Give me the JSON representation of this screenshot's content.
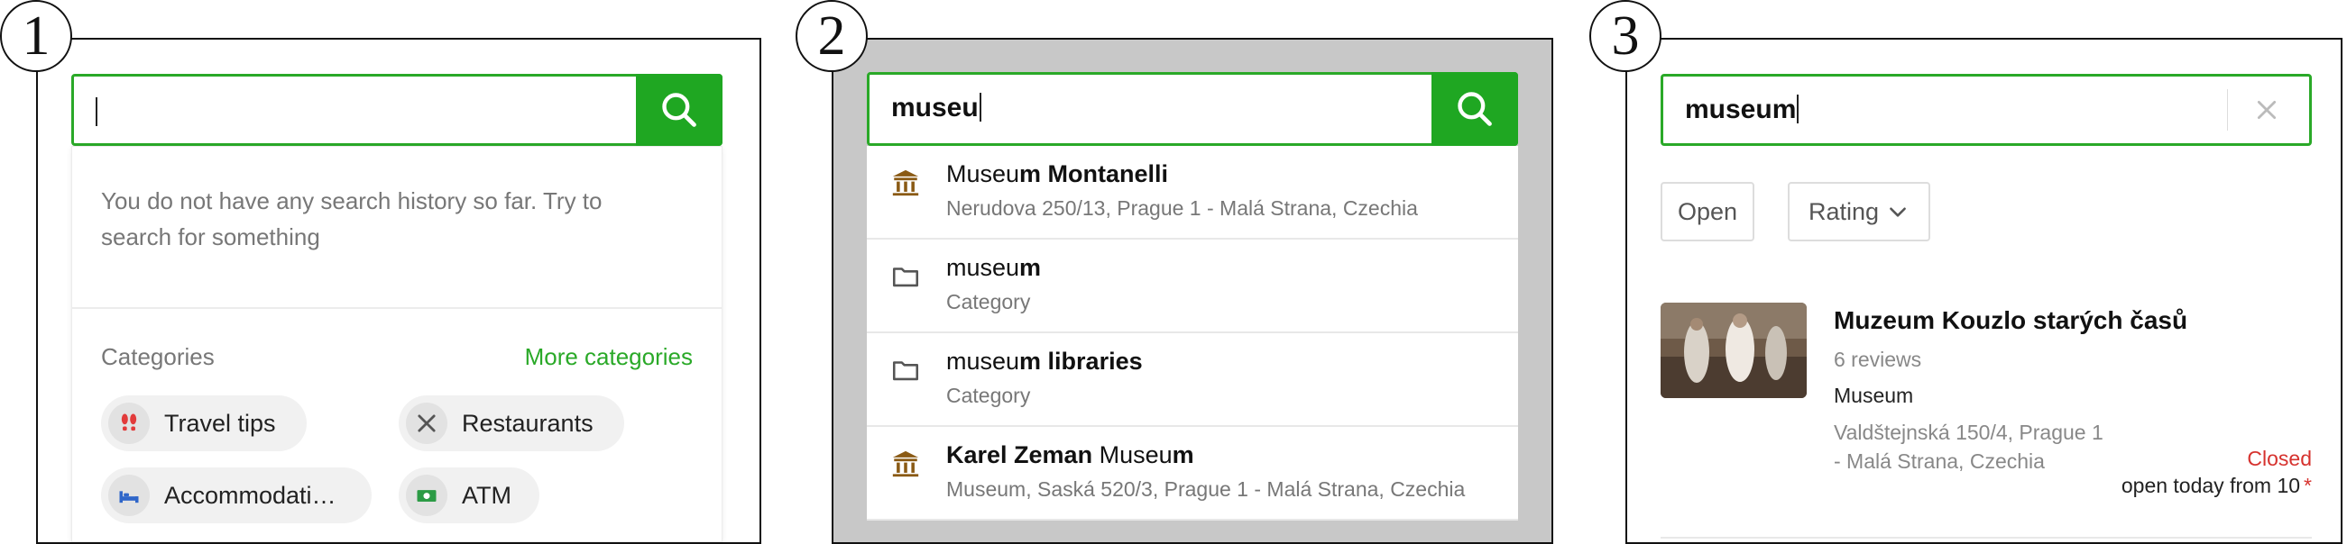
{
  "steps": [
    "1",
    "2",
    "3"
  ],
  "colors": {
    "accent": "#1fa722",
    "closed": "#d6322e",
    "museum_icon": "#8a5a14"
  },
  "panel1": {
    "search": {
      "value": ""
    },
    "empty_history": "You do not have any search history so far. Try to search for something",
    "categories_title": "Categories",
    "more_categories": "More categories",
    "chips": [
      {
        "label": "Travel tips",
        "icon": "footprints-icon"
      },
      {
        "label": "Restaurants",
        "icon": "cutlery-icon"
      },
      {
        "label": "Accommodati…",
        "icon": "bed-icon"
      },
      {
        "label": "ATM",
        "icon": "cash-icon"
      }
    ]
  },
  "panel2": {
    "search": {
      "value": "museu"
    },
    "suggestions": [
      {
        "icon": "museum-icon",
        "title_plain": "Museu",
        "title_bold": "m Montanelli",
        "subtitle": "Nerudova 250/13, Prague 1 - Malá Strana, Czechia"
      },
      {
        "icon": "folder-icon",
        "title_plain": "museu",
        "title_bold": "m",
        "subtitle": "Category"
      },
      {
        "icon": "folder-icon",
        "title_plain": "museu",
        "title_bold": "m libraries",
        "subtitle": "Category"
      },
      {
        "icon": "museum-icon",
        "title_bold_lead": "Karel Zeman",
        "title_plain": " Museu",
        "title_bold": "m",
        "subtitle": "Museum, Saská 520/3, Prague 1 - Malá Strana, Czechia"
      }
    ]
  },
  "panel3": {
    "search": {
      "value": "museum"
    },
    "filters": {
      "open": "Open",
      "rating": "Rating"
    },
    "result": {
      "title": "Muzeum Kouzlo starých časů",
      "reviews": "6 reviews",
      "category": "Museum",
      "address": "Valdštejnská 150/4, Prague 1 - Malá Strana, Czechia",
      "status": "Closed",
      "hours": "open today from 10",
      "hours_marker": "*"
    }
  }
}
